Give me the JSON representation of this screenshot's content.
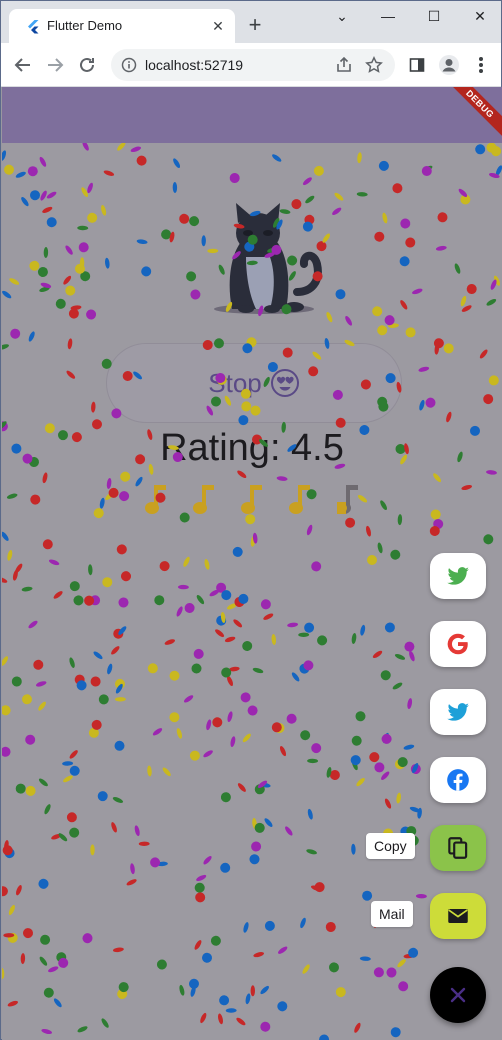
{
  "browser": {
    "tab_title": "Flutter Demo",
    "url": "localhost:52719",
    "window_controls": [
      "minimize",
      "maximize",
      "close"
    ]
  },
  "app": {
    "debug_banner": "DEBUG",
    "stop_button": {
      "label": "Stop",
      "emoji_icon": "heart-eyes-emoji"
    },
    "rating_text": "Rating: 4.5",
    "rating_value": 4.5,
    "rating_max": 5,
    "colors": {
      "appbar": "#7e6f9c",
      "accent": "#5a4a86",
      "twitter_green": "#4caf50",
      "twitter_cyan": "#1da1f2",
      "facebook": "#1877f2",
      "copy_fab": "#8bc34a",
      "mail_fab": "#cddc39"
    }
  },
  "speed_dial": {
    "actions": [
      {
        "name": "twitter-green",
        "icon": "twitter-icon",
        "label": ""
      },
      {
        "name": "google",
        "icon": "google-icon",
        "label": ""
      },
      {
        "name": "twitter-cyan",
        "icon": "twitter-icon",
        "label": ""
      },
      {
        "name": "facebook",
        "icon": "facebook-icon",
        "label": ""
      },
      {
        "name": "copy",
        "icon": "copy-icon",
        "label": "Copy"
      },
      {
        "name": "mail",
        "icon": "mail-icon",
        "label": "Mail"
      }
    ],
    "main_icon": "close-icon"
  }
}
